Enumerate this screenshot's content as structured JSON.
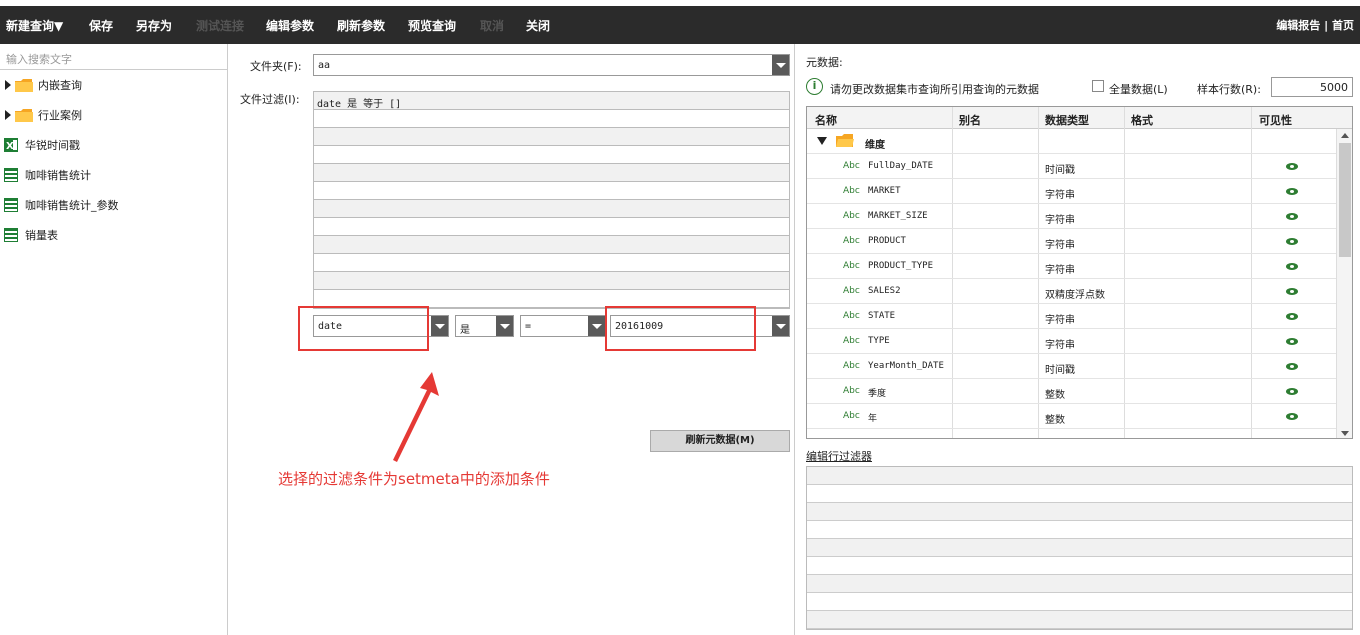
{
  "toolbar": {
    "new_query": "新建查询▼",
    "save": "保存",
    "save_as": "另存为",
    "test_connect": "测试连接",
    "edit_params": "编辑参数",
    "refresh_params": "刷新参数",
    "preview_query": "预览查询",
    "cancel": "取消",
    "close": "关闭",
    "right_links": "编辑报告 | 首页"
  },
  "sidebar": {
    "search_placeholder": "输入搜索文字",
    "items": [
      {
        "label": "内嵌查询",
        "icon": "folder-icon"
      },
      {
        "label": "行业案例",
        "icon": "folder-icon"
      },
      {
        "label": "华锐时间戳",
        "icon": "excel-icon"
      },
      {
        "label": "咖啡销售统计",
        "icon": "table-icon"
      },
      {
        "label": "咖啡销售统计_参数",
        "icon": "table-icon"
      },
      {
        "label": "销量表",
        "icon": "table-icon"
      }
    ]
  },
  "form": {
    "folder_label": "文件夹(F):",
    "folder_value": "aa",
    "filter_label": "文件过滤(I):",
    "filter_rows": [
      "date 是 等于 []",
      "",
      "",
      "",
      "",
      "",
      "",
      "",
      "",
      "",
      "",
      ""
    ],
    "cond_field": "date",
    "cond_is": "是",
    "cond_op": "=",
    "cond_value": "20161009",
    "refresh_meta_button": "刷新元数据(M)",
    "annotation": "选择的过滤条件为setmeta中的添加条件"
  },
  "meta": {
    "title": "元数据:",
    "notice": "请勿更改数据集市查询所引用查询的元数据",
    "full_data_label": "全量数据(L)",
    "sample_rows_label": "样本行数(R):",
    "sample_rows_value": "5000",
    "columns": [
      "名称",
      "别名",
      "数据类型",
      "格式",
      "可见性"
    ],
    "group_label": "维度",
    "rows": [
      {
        "name": "FullDay_DATE",
        "type": "时间戳"
      },
      {
        "name": "MARKET",
        "type": "字符串"
      },
      {
        "name": "MARKET_SIZE",
        "type": "字符串"
      },
      {
        "name": "PRODUCT",
        "type": "字符串"
      },
      {
        "name": "PRODUCT_TYPE",
        "type": "字符串"
      },
      {
        "name": "SALES2",
        "type": "双精度浮点数"
      },
      {
        "name": "STATE",
        "type": "字符串"
      },
      {
        "name": "TYPE",
        "type": "字符串"
      },
      {
        "name": "YearMonth_DATE",
        "type": "时间戳"
      },
      {
        "name": "季度",
        "type": "整数"
      },
      {
        "name": "年",
        "type": "整数"
      }
    ],
    "abc_tag": "Abc",
    "edit_filter_link": "编辑行过滤器"
  }
}
